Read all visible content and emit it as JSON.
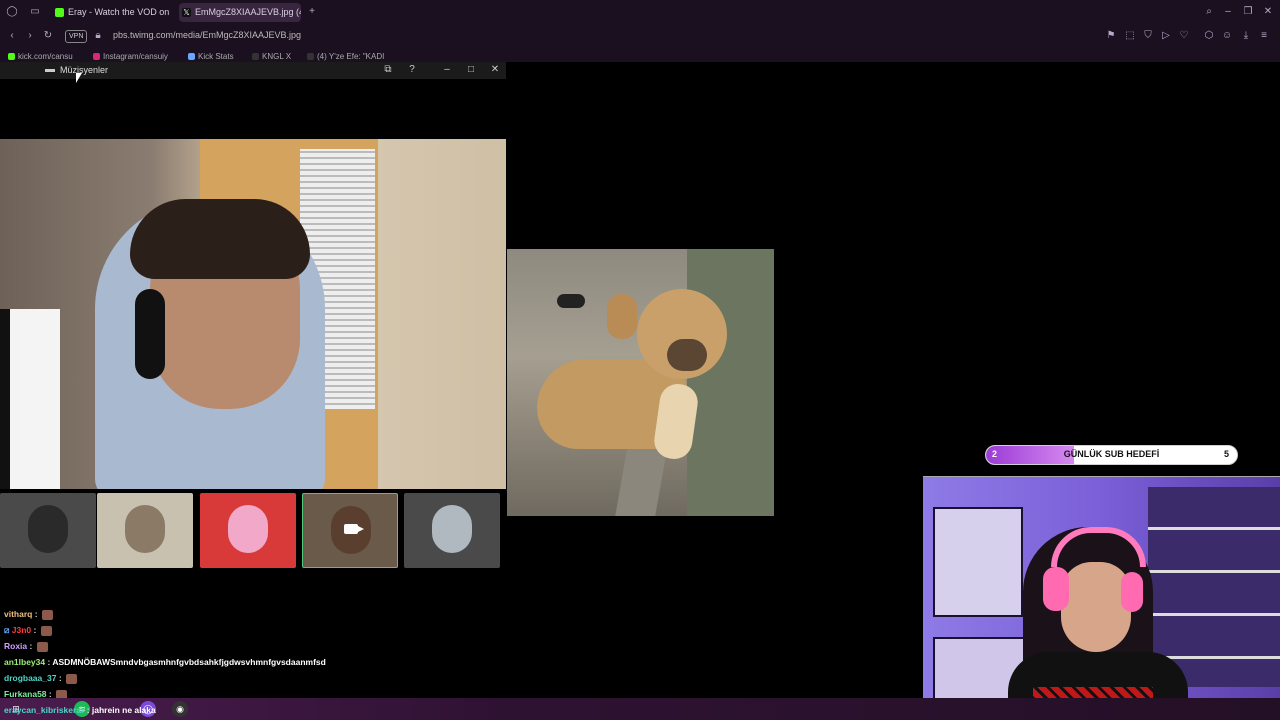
{
  "browser": {
    "tabs": [
      {
        "label": "Eray - Watch the VOD on K",
        "favicon": "kick-icon"
      },
      {
        "label": "EmMgcZ8XIAAJEVB.jpg (4",
        "favicon": "x-icon"
      }
    ],
    "new_tab": "+",
    "vpn_badge": "VPN",
    "address": "pbs.twimg.com/media/EmMgcZ8XIAAJEVB.jpg",
    "bookmarks": [
      "kick.com/cansu",
      "Instagram/cansuiy",
      "Kick Stats",
      "KNGL X",
      "(4) Y'ze Efe: \"KADI"
    ]
  },
  "musicians_window": {
    "title": "Müzisyenler",
    "controls": [
      "pip-icon",
      "help-icon",
      "minimize-icon",
      "maximize-icon",
      "close-icon"
    ]
  },
  "sub_goal": {
    "start": "2",
    "label": "GÜNLÜK SUB HEDEFİ",
    "end": "5",
    "progress": 0.35,
    "fill_color": "#9b3bd6"
  },
  "chat": [
    {
      "user": "vitharq",
      "sep": " : ",
      "message": "",
      "color": "#f0c080",
      "emote": true
    },
    {
      "user": "J3n0",
      "sep": " : ",
      "message": "",
      "color": "#ff3b3b",
      "emote": true
    },
    {
      "user": "Roxia",
      "sep": " : ",
      "message": "",
      "color": "#d0a0ff",
      "emote": true
    },
    {
      "user": "an1lbey34",
      "sep": " : ",
      "message": "ASDMNÖBAWSmndvbgasmhnfgvbdsahkfjgdwsvhmnfgvsdaanmfsd",
      "color": "#9ef07a",
      "emote": false
    },
    {
      "user": "drogbaaa_37",
      "sep": " : ",
      "message": "",
      "color": "#4fd6c8",
      "emote": true
    },
    {
      "user": "Furkana58",
      "sep": " : ",
      "message": "",
      "color": "#7ef0a0",
      "emote": true
    },
    {
      "user": "eraycan_kibriskerar",
      "sep": " : ",
      "message": "jahrein ne alaka",
      "color": "#4fd6c8",
      "emote": false
    }
  ],
  "taskbar": {
    "icons": [
      "windows-icon",
      "spotify-icon",
      "opera-icon",
      "obs-icon"
    ]
  }
}
